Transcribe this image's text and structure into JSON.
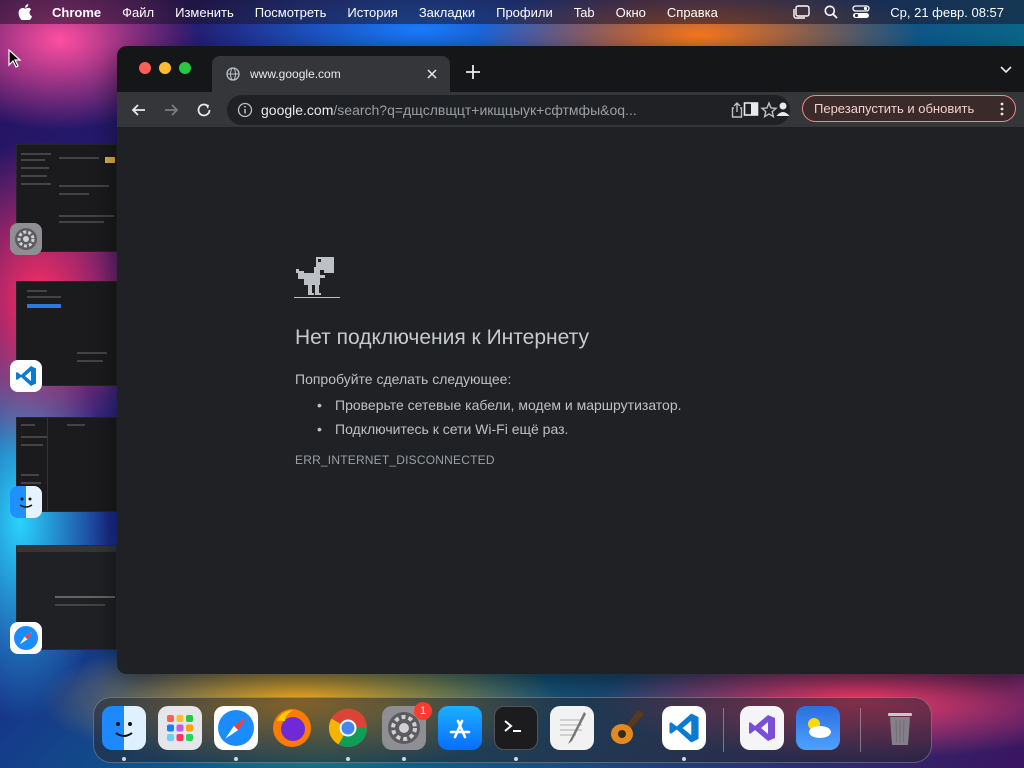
{
  "menubar": {
    "app_name": "Chrome",
    "items": [
      "Файл",
      "Изменить",
      "Посмотреть",
      "История",
      "Закладки",
      "Профили",
      "Tab",
      "Окно",
      "Справка"
    ],
    "clock": "Ср, 21 февр.  08:57"
  },
  "browser": {
    "tab_title": "www.google.com",
    "url_host": "google.com",
    "url_rest": "/search?q=дщслвщцт+икщцыук+сфтмфы&oq...",
    "relaunch_label": "Перезапустить и обновить"
  },
  "error_page": {
    "title": "Нет подключения к Интернету",
    "suggest": "Попробуйте сделать следующее:",
    "tips": [
      "Проверьте сетевые кабели, модем и маршрутизатор.",
      "Подключитесь к сети Wi-Fi ещё раз."
    ],
    "code": "ERR_INTERNET_DISCONNECTED"
  },
  "dock": {
    "apps": [
      "finder",
      "launchpad",
      "safari",
      "firefox",
      "chrome",
      "system-settings",
      "app-store",
      "terminal",
      "textedit",
      "garageband",
      "vscode",
      "visual-studio",
      "weather",
      "trash"
    ],
    "settings_badge": "1"
  },
  "colors": {
    "window_bg": "#202124",
    "toolbar_bg": "#35363a",
    "relaunch_border": "#f28b82",
    "traffic_red": "#ff5f57",
    "traffic_yellow": "#febc2e",
    "traffic_green": "#28c840"
  }
}
